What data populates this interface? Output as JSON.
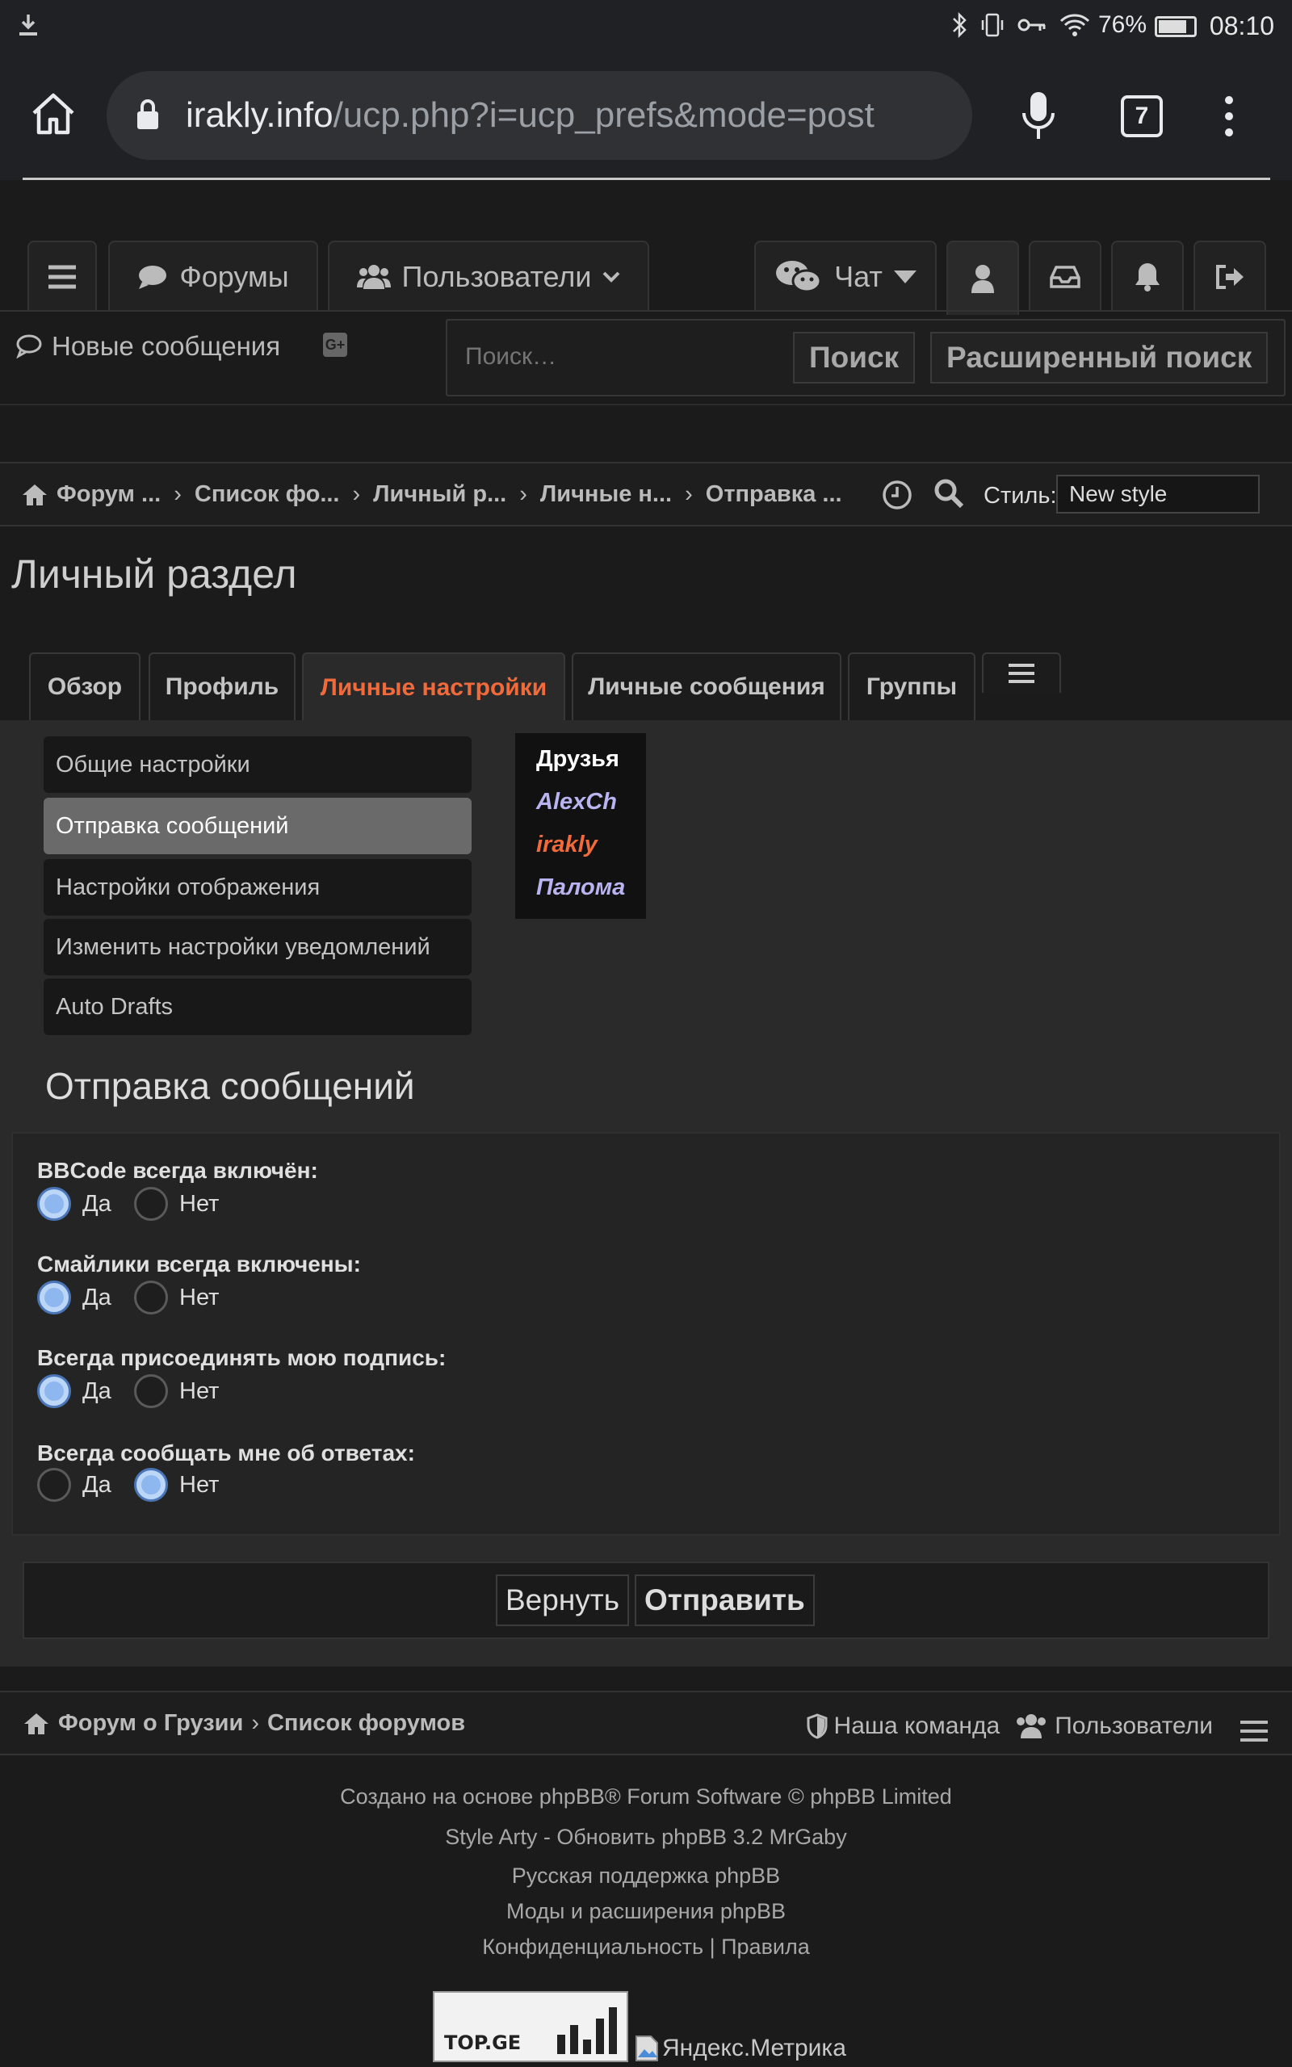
{
  "status_bar": {
    "battery": "76%",
    "time": "08:10"
  },
  "browser": {
    "url_host": "irakly.info",
    "url_path": "/ucp.php?i=ucp_prefs&mode=post",
    "tab_count": "7"
  },
  "nav": {
    "forums": "Форумы",
    "users": "Пользователи",
    "chat": "Чат"
  },
  "subnav": {
    "new_messages": "Новые сообщения",
    "gplus": "G+"
  },
  "search": {
    "placeholder": "Поиск…",
    "search_button": "Поиск",
    "advanced_button": "Расширенный поиск"
  },
  "breadcrumbs": [
    "Форум ...",
    "Список фо...",
    "Личный р...",
    "Личные н...",
    "Отправка ..."
  ],
  "style": {
    "label": "Стиль:",
    "value": "New style"
  },
  "page_title": "Личный раздел",
  "tabs": [
    "Обзор",
    "Профиль",
    "Личные настройки",
    "Личные сообщения",
    "Группы"
  ],
  "side_menu": [
    "Общие настройки",
    "Отправка сообщений",
    "Настройки отображения",
    "Изменить настройки уведомлений",
    "Auto Drafts"
  ],
  "friends": {
    "title": "Друзья",
    "list": [
      "AlexCh",
      "irakly",
      "Палома"
    ]
  },
  "section_title": "Отправка сообщений",
  "options": [
    {
      "label": "BBCode всегда включён:",
      "yes": "Да",
      "no": "Нет",
      "selected": "yes"
    },
    {
      "label": "Смайлики всегда включены:",
      "yes": "Да",
      "no": "Нет",
      "selected": "yes"
    },
    {
      "label": "Всегда присоединять мою подпись:",
      "yes": "Да",
      "no": "Нет",
      "selected": "yes"
    },
    {
      "label": "Всегда сообщать мне об ответах:",
      "yes": "Да",
      "no": "Нет",
      "selected": "no"
    }
  ],
  "buttons": {
    "reset": "Вернуть",
    "submit": "Отправить"
  },
  "footer": {
    "crumbs": [
      "Форум о Грузии",
      "Список форумов"
    ],
    "team": "Наша команда",
    "users": "Пользователи",
    "credits": [
      "Создано на основе phpBB® Forum Software © phpBB Limited",
      "Style Arty - Обновить phpBB 3.2 MrGaby",
      "Русская поддержка phpBB",
      "Моды и расширения phpBB",
      "Конфиденциальность | Правила"
    ],
    "topge": "TOP.GE",
    "metrika": "Яндекс.Метрика"
  },
  "colors": {
    "accent": "#f06a3c",
    "friend_link": "#b7b4f0",
    "radio_selected": "#8fb7ef"
  }
}
